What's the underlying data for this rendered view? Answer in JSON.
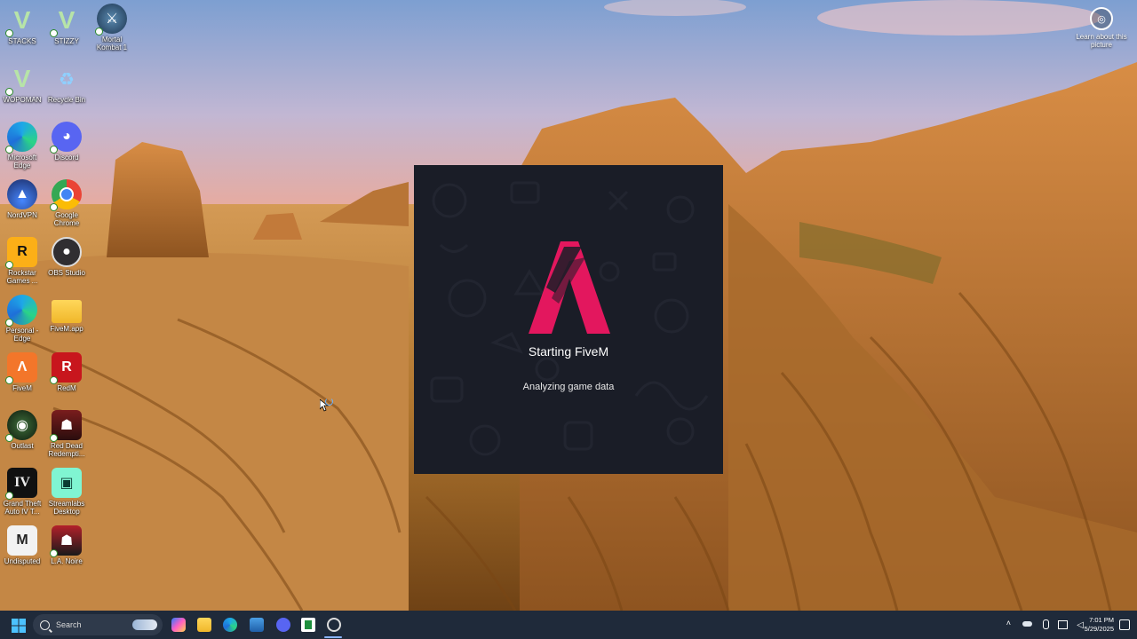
{
  "desktop_icons": [
    {
      "label": "STACKS"
    },
    {
      "label": "STIZZY"
    },
    {
      "label": "Mortal Kombat 1"
    },
    {
      "label": "WOPOMAN"
    },
    {
      "label": "Recycle Bin"
    },
    {
      "label": "Microsoft Edge"
    },
    {
      "label": "Discord"
    },
    {
      "label": "NordVPN"
    },
    {
      "label": "Google Chrome"
    },
    {
      "label": "Rockstar Games ..."
    },
    {
      "label": "OBS Studio"
    },
    {
      "label": "Personal - Edge"
    },
    {
      "label": "FiveM.app"
    },
    {
      "label": "FiveM"
    },
    {
      "label": "RedM"
    },
    {
      "label": "Outlast"
    },
    {
      "label": "Red Dead Redempti..."
    },
    {
      "label": "Grand Theft Auto IV T..."
    },
    {
      "label": "Streamlabs Desktop"
    },
    {
      "label": "Undisputed"
    },
    {
      "label": "L.A. Noire"
    }
  ],
  "learn_about": {
    "label": "Learn about this picture"
  },
  "splash": {
    "title": "Starting FiveM",
    "status": "Analyzing game data",
    "accent_color": "#e3175e"
  },
  "taskbar": {
    "search_placeholder": "Search",
    "clock_time": "7:01 PM",
    "clock_date": "5/29/2025"
  }
}
